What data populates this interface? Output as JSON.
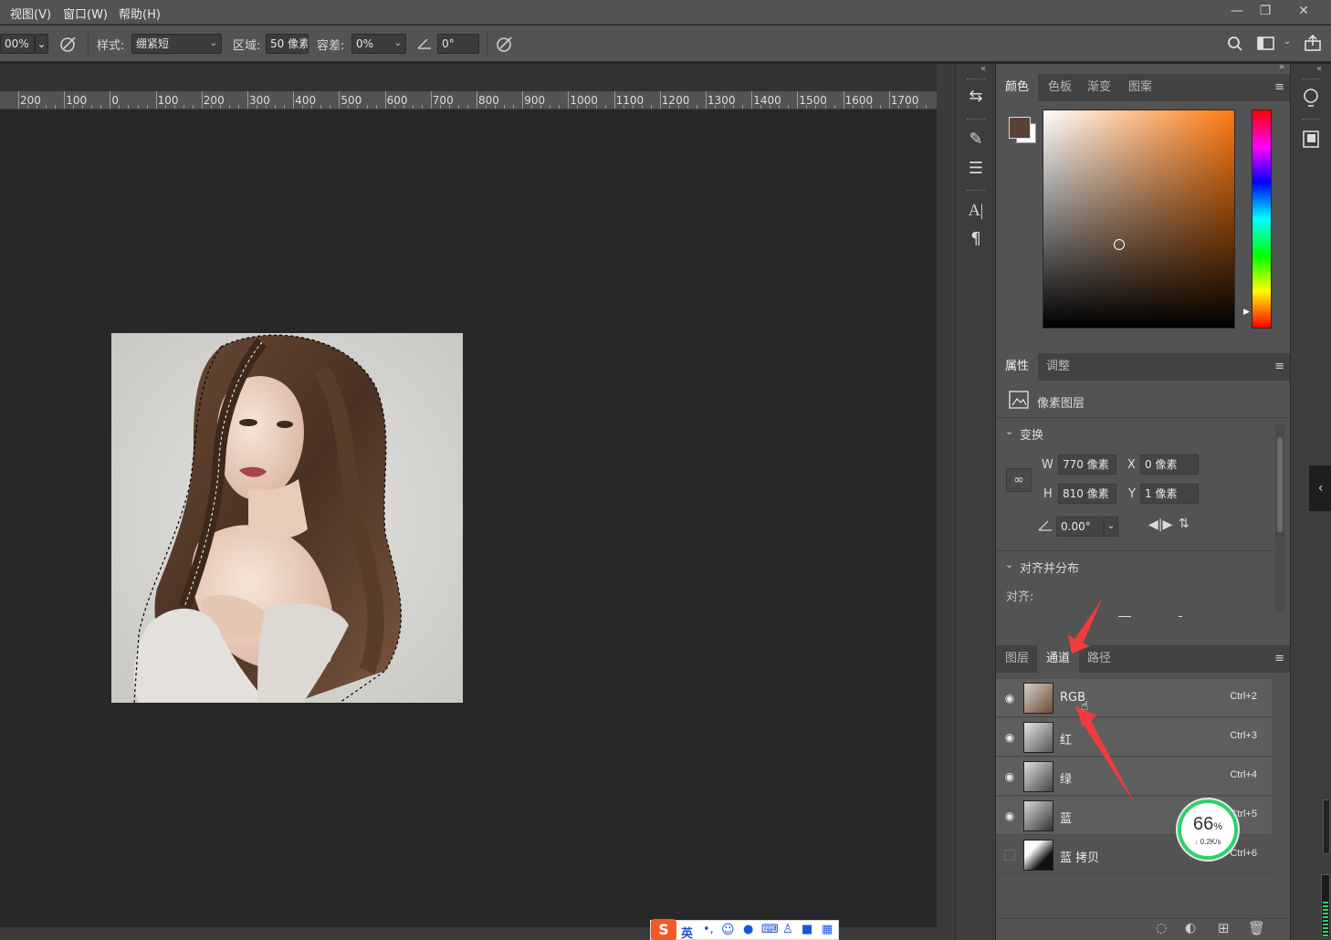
{
  "menubar": {
    "items": [
      "视图(V)",
      "窗口(W)",
      "帮助(H)"
    ],
    "controls": [
      "minimize-icon",
      "restore-icon",
      "close-icon"
    ]
  },
  "options": {
    "zoom_value": "00%",
    "style_label": "样式:",
    "style_value": "绷紧短",
    "area_label": "区域:",
    "area_value": "50 像素",
    "tolerance_label": "容差:",
    "tolerance_value": "0%",
    "angle_value": "0°"
  },
  "ruler": {
    "ticks": [
      "200",
      "100",
      "0",
      "100",
      "200",
      "300",
      "400",
      "500",
      "600",
      "700",
      "800",
      "900",
      "1000",
      "1100",
      "1200",
      "1300",
      "1400",
      "1500",
      "1600",
      "1700"
    ]
  },
  "color_panel": {
    "tabs": [
      "颜色",
      "色板",
      "渐变",
      "图案"
    ],
    "active_tab": 0,
    "foreground_color": "#5a4235",
    "background_color": "#ffffff",
    "picker_hue": "#ff7a10"
  },
  "properties_panel": {
    "tabs": [
      "属性",
      "调整"
    ],
    "active_tab": 0,
    "layer_type": "像素图层",
    "transform_title": "变换",
    "w_label": "W",
    "w_value": "770 像素",
    "h_label": "H",
    "h_value": "810 像素",
    "x_label": "X",
    "x_value": "0 像素",
    "y_label": "Y",
    "y_value": "1 像素",
    "angle_value": "0.00°",
    "align_title": "对齐并分布",
    "align_label": "对齐:"
  },
  "channels_panel": {
    "tabs": [
      "图层",
      "通道",
      "路径"
    ],
    "active_tab": 1,
    "channels": [
      {
        "name": "RGB",
        "shortcut": "Ctrl+2",
        "visible": true
      },
      {
        "name": "红",
        "shortcut": "Ctrl+3",
        "visible": true
      },
      {
        "name": "绿",
        "shortcut": "Ctrl+4",
        "visible": true
      },
      {
        "name": "蓝",
        "shortcut": "Ctrl+5",
        "visible": true
      },
      {
        "name": "蓝 拷贝",
        "shortcut": "Ctrl+6",
        "visible": false
      }
    ]
  },
  "net_widget": {
    "percent": "66",
    "percent_sign": "%",
    "speed": "0.2K/s"
  },
  "ime": {
    "mode": "英"
  }
}
